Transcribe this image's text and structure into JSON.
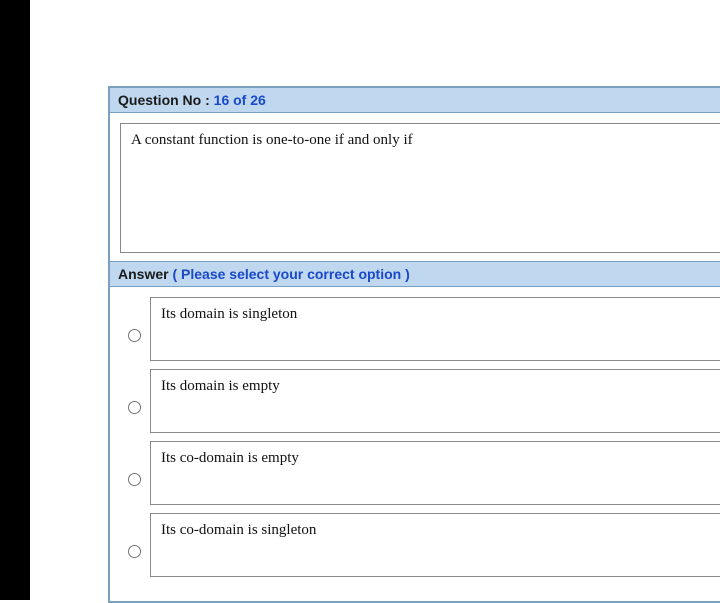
{
  "header": {
    "label": "Question No :",
    "qno": "16 of 26"
  },
  "question": {
    "text": "A constant function is one-to-one if and only if"
  },
  "answer_header": {
    "label": "Answer",
    "hint": "( Please select your correct option )"
  },
  "options": [
    {
      "text": "Its domain is singleton"
    },
    {
      "text": "Its domain is empty"
    },
    {
      "text": "Its co-domain is empty"
    },
    {
      "text": "Its co-domain is singleton"
    }
  ]
}
